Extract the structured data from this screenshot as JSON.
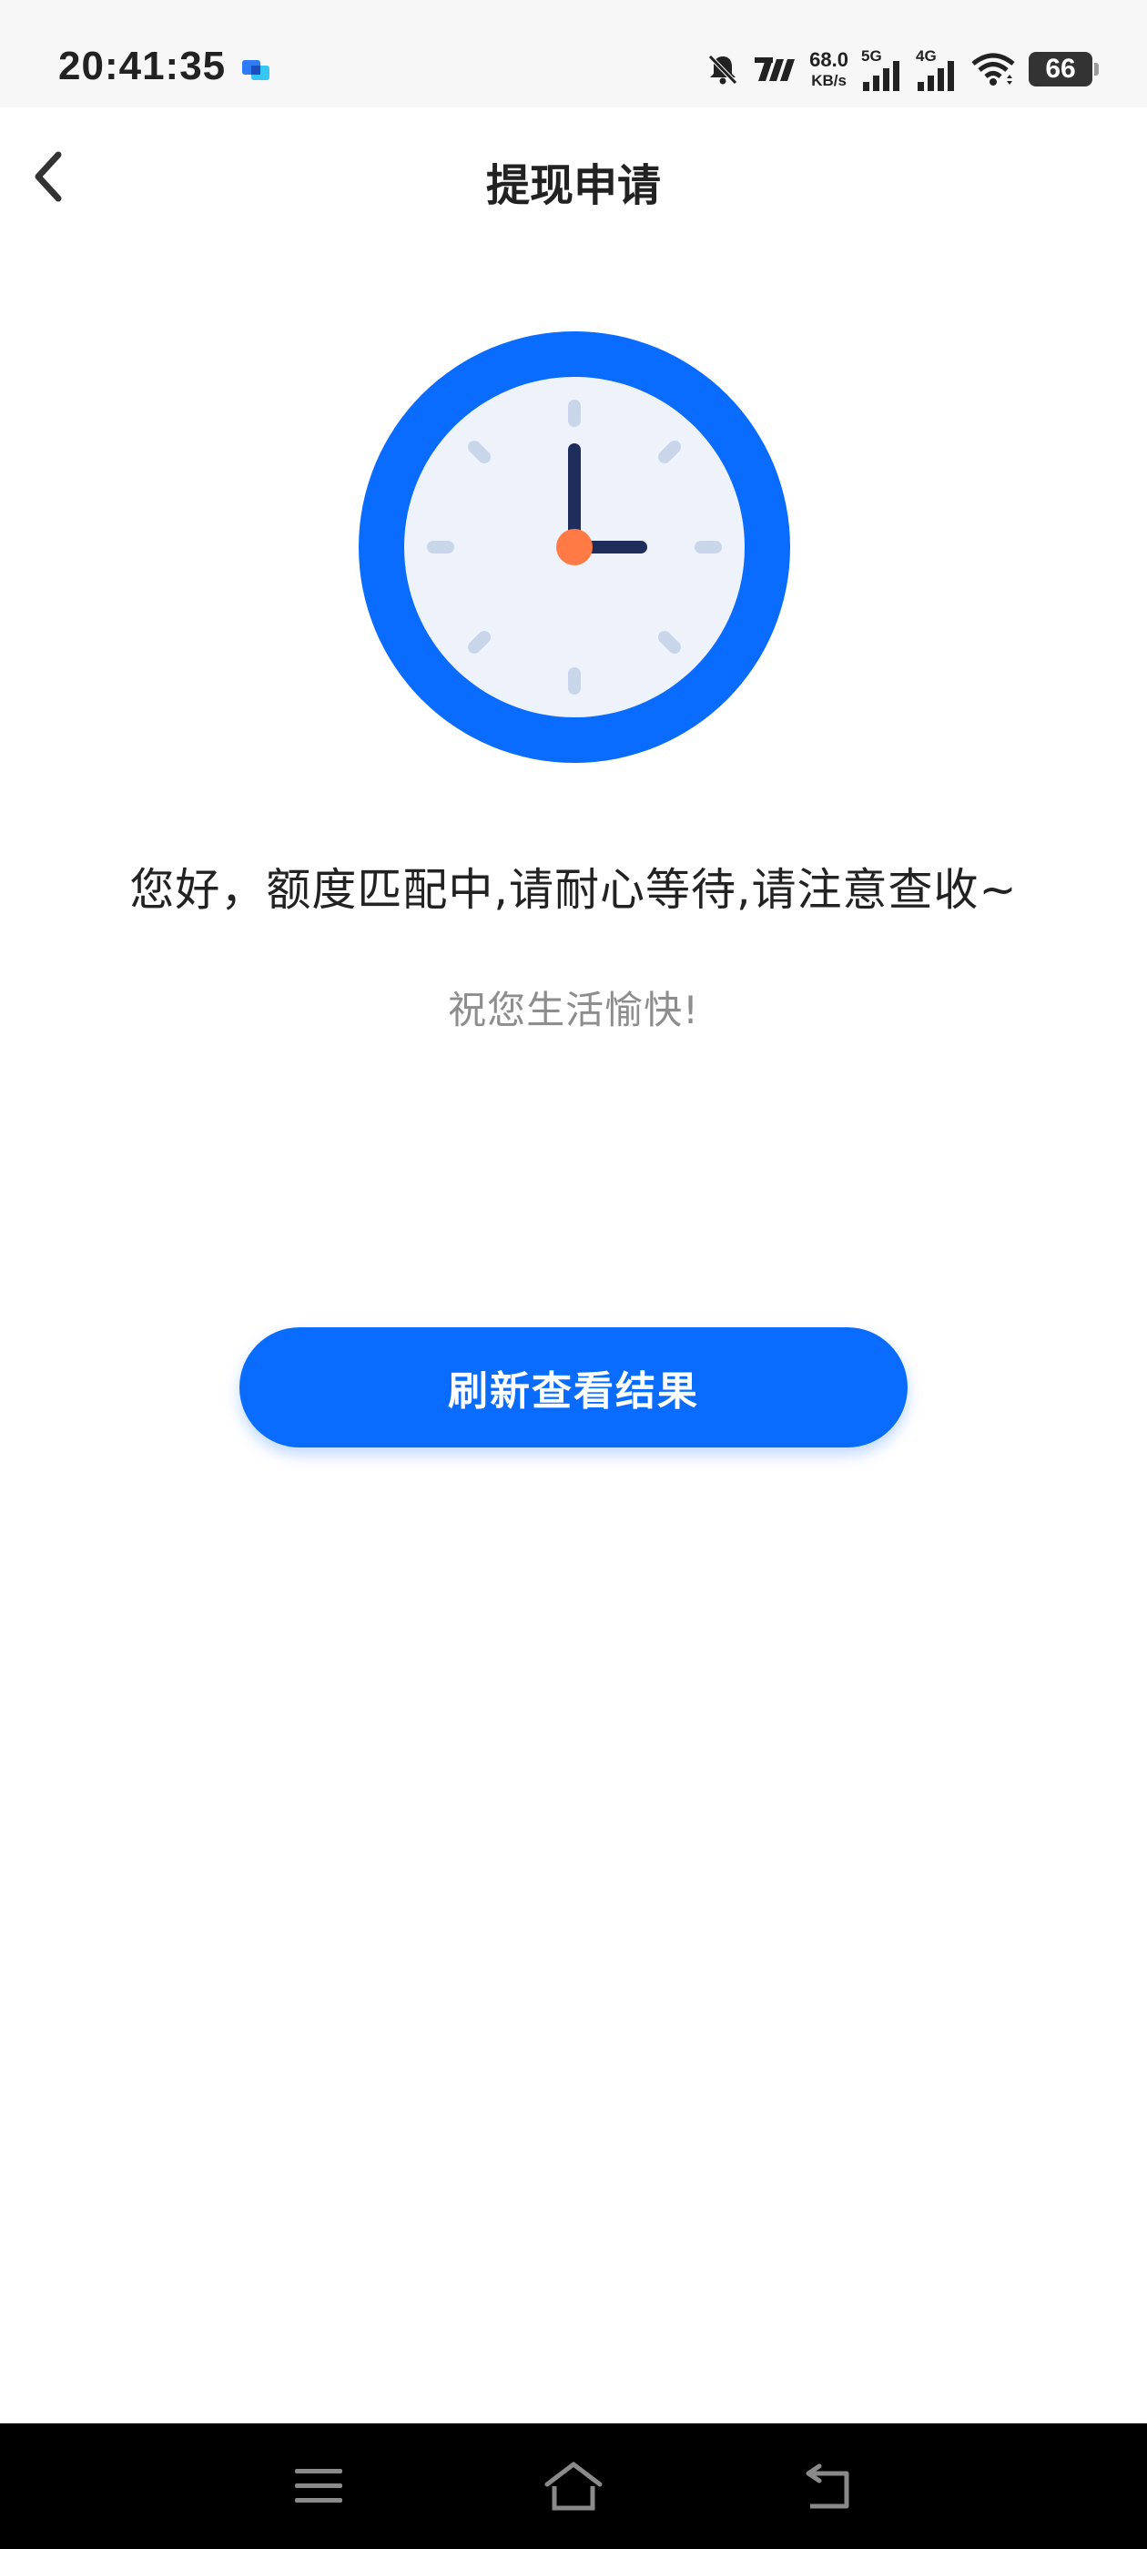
{
  "status_bar": {
    "time": "20:41:35",
    "net_speed_value": "68.0",
    "net_speed_unit": "KB/s",
    "signal1_label": "5G",
    "signal2_label": "4G",
    "battery_level": "66"
  },
  "header": {
    "title": "提现申请"
  },
  "main": {
    "message": "您好，额度匹配中,请耐心等待,请注意查收~",
    "sub_message": "祝您生活愉快!",
    "refresh_button_label": "刷新查看结果"
  },
  "colors": {
    "accent": "#0a6cff",
    "clock_face": "#eef3fb",
    "clock_hand": "#1f2d5c",
    "clock_center": "#ff7a45"
  }
}
